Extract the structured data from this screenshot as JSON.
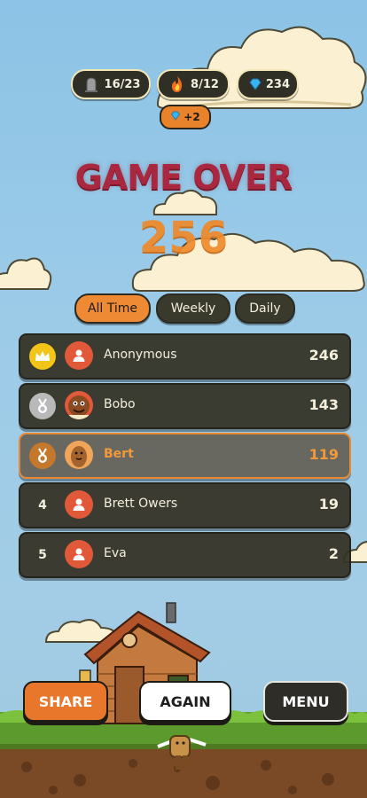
{
  "stats": [
    {
      "icon": "tombstone-icon",
      "value": "16/23"
    },
    {
      "icon": "fire-icon",
      "value": "8/12"
    },
    {
      "icon": "gem-icon",
      "value": "234"
    }
  ],
  "bonus": {
    "icon": "gem-icon",
    "value": "+2"
  },
  "title": "GAME OVER",
  "score": "256",
  "tabs": [
    {
      "label": "All Time",
      "active": true
    },
    {
      "label": "Weekly",
      "active": false
    },
    {
      "label": "Daily",
      "active": false
    }
  ],
  "leaderboard": [
    {
      "rank": "",
      "medal": "crown-icon",
      "avatar": "user-icon",
      "name": "Anonymous",
      "points": "246",
      "current": false
    },
    {
      "rank": "",
      "medal": "silver-medal-icon",
      "avatar": "bobo-character-icon",
      "name": "Bobo",
      "points": "143",
      "current": false
    },
    {
      "rank": "",
      "medal": "bronze-medal-icon",
      "avatar": "bert-character-icon",
      "name": "Bert",
      "points": "119",
      "current": true
    },
    {
      "rank": "4",
      "medal": "",
      "avatar": "user-icon",
      "name": "Brett Owers",
      "points": "19",
      "current": false
    },
    {
      "rank": "5",
      "medal": "",
      "avatar": "user-icon",
      "name": "Eva",
      "points": "2",
      "current": false
    }
  ],
  "buttons": {
    "share": "SHARE",
    "again": "AGAIN",
    "menu": "MENU"
  },
  "colors": {
    "accent": "#e8772c",
    "title": "#a9283f",
    "score": "#f08a2a",
    "row": "#343225"
  }
}
